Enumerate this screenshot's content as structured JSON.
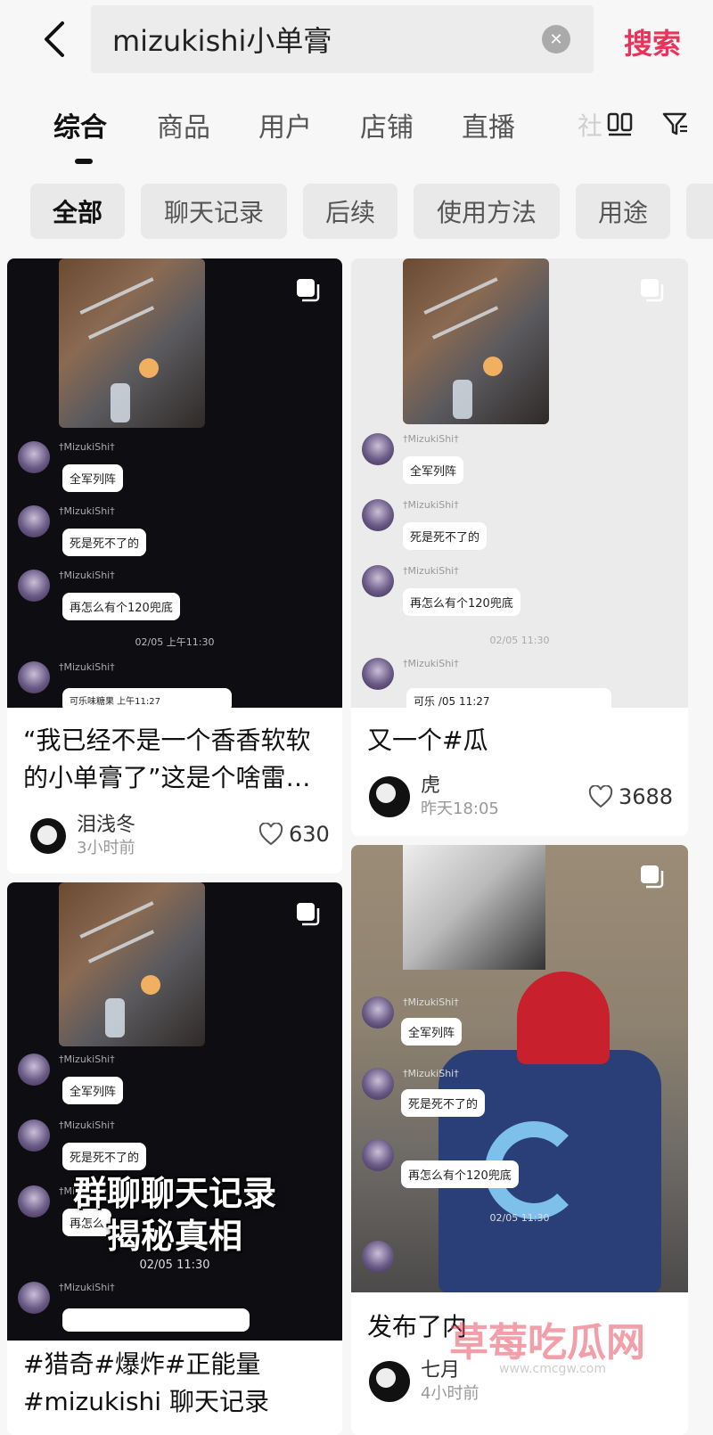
{
  "search": {
    "value": "mizukishi小单膏",
    "clear_icon": "close-circle-icon",
    "button_label": "搜索"
  },
  "tabs": [
    {
      "label": "综合",
      "active": true
    },
    {
      "label": "商品"
    },
    {
      "label": "用户"
    },
    {
      "label": "店铺"
    },
    {
      "label": "直播"
    },
    {
      "label": "社"
    }
  ],
  "chips": [
    {
      "label": "全部",
      "active": true
    },
    {
      "label": "聊天记录"
    },
    {
      "label": "后续"
    },
    {
      "label": "使用方法"
    },
    {
      "label": "用途"
    }
  ],
  "colors": {
    "accent": "#e8335a",
    "bg": "#f7f7f7",
    "chip_bg": "#e9e9e9"
  },
  "cards": {
    "c1": {
      "chat": [
        {
          "user": "†MizukiShi†",
          "text": "全军列阵"
        },
        {
          "user": "†MizukiShi†",
          "text": "死是死不了的"
        },
        {
          "user": "†MizukiShi†",
          "text": "再怎么有个120兜底"
        }
      ],
      "stamp": "02/05 上午11:30",
      "last_user": "†MizukiShi†",
      "partial_bubble": "可乐味糖果 上午11:27",
      "title": "“我已经不是一个香香软软的小单膏了”这是个啥雷…",
      "author": "泪浅冬",
      "time": "3小时前",
      "likes": "630"
    },
    "c2": {
      "chat": [
        {
          "user": "†MizukiShi†",
          "text": "全军列阵"
        },
        {
          "user": "†MizukiShi†",
          "text": "死是死不了的"
        },
        {
          "user": "†MizukiShi†",
          "text": "再怎么有个120兜底"
        }
      ],
      "stamp": "02/05 11:30",
      "last_user": "†MizukiShi†",
      "partial_bubble": "可乐 /05 11:27",
      "title": "又一个#瓜",
      "author": "虎",
      "time": "昨天18:05",
      "likes": "3688"
    },
    "c3": {
      "chat": [
        {
          "user": "†MizukiShi†",
          "text": "全军列阵"
        },
        {
          "user": "†MizukiShi†",
          "text": "死是死不了的"
        },
        {
          "user": "†MizukiShi†",
          "text": "再怎么"
        }
      ],
      "overlay_line1": "群聊聊天记录",
      "overlay_line2": "揭秘真相",
      "stamp": "02/05 11:30",
      "last_user": "†MizukiShi†",
      "title": "#猎奇#爆炸#正能量",
      "title2": "#mizukishi 聊天记录"
    },
    "c4": {
      "chat": [
        {
          "user": "†MizukiShi†",
          "text": "全军列阵"
        },
        {
          "user": "†MizukiShi†",
          "text": "死是死不了的"
        },
        {
          "user": "",
          "text": "再怎么有个120兜底"
        }
      ],
      "stamp": "02/05 11:30",
      "title": "发布了内",
      "author": "七月",
      "time": "4小时前"
    }
  },
  "watermark": {
    "text": "草莓吃瓜网",
    "sub": "www.cmcgw.com"
  }
}
